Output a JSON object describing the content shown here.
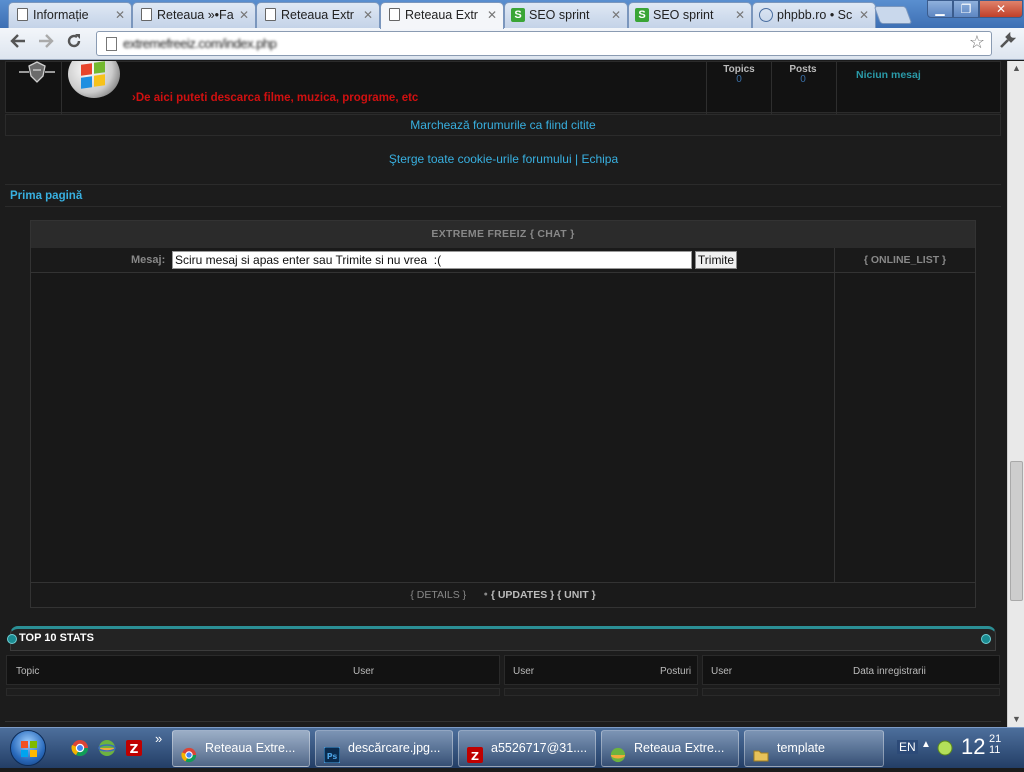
{
  "browser": {
    "tabs": [
      {
        "label": "Informație",
        "icon": "document-icon"
      },
      {
        "label": "Reteaua »•Fa",
        "icon": "document-icon"
      },
      {
        "label": "Reteaua Extr",
        "icon": "document-icon"
      },
      {
        "label": "Reteaua Extr",
        "icon": "document-icon",
        "active": true
      },
      {
        "label": "SEO sprint",
        "icon": "seo-sprint-icon"
      },
      {
        "label": "SEO sprint",
        "icon": "seo-sprint-icon"
      },
      {
        "label": "phpbb.ro • Sc",
        "icon": "phpbb-icon"
      }
    ],
    "tab_close": "✕",
    "url": "extremefreeiz.com/index.php",
    "nav": {
      "back": "back-arrow-icon",
      "forward": "forward-arrow-icon",
      "reload": "reload-icon",
      "bookmark": "star-icon",
      "menu": "wrench-icon"
    }
  },
  "forum": {
    "description": "›De aici puteti descarca filme, muzica, programe, etc",
    "topics_label": "Topics",
    "topics_value": "0",
    "posts_label": "Posts",
    "posts_value": "0",
    "last_post": "Niciun mesaj",
    "mark_read": "Marchează forumurile ca fiind citite",
    "delete_cookies": "Şterge toate cookie-urile forumului",
    "separator": "|",
    "team": "Echipa",
    "breadcrumb": "Prima pagină"
  },
  "chat": {
    "title": "EXTREME FREEIZ { CHAT }",
    "message_label": "Mesaj:",
    "input_value": "Sciru mesaj si apas enter sau Trimite si nu vrea  :(",
    "send_label": "Trimite",
    "online_list": "{ ONLINE_LIST }",
    "footer_details": "{ DETAILS }",
    "footer_bullet": "●",
    "footer_updates": "{ UPDATES }",
    "footer_unit": "{ UNIT }"
  },
  "stats": {
    "title": "TOP 10 STATS",
    "columns": {
      "topic": "Topic",
      "topic_user": "User",
      "posters_user": "User",
      "posts": "Posturi",
      "new_user": "User",
      "reg_date": "Data inregistrarii"
    }
  },
  "taskbar": {
    "items": [
      {
        "label": "Reteaua Extre...",
        "icon": "chrome-icon",
        "active": true
      },
      {
        "label": "descărcare.jpg...",
        "icon": "photoshop-icon"
      },
      {
        "label": "a5526717@31....",
        "icon": "filezilla-icon"
      },
      {
        "label": "Reteaua Extre...",
        "icon": "browser-icon"
      },
      {
        "label": "template",
        "icon": "folder-icon"
      }
    ],
    "quicklaunch_more": "»",
    "language": "EN",
    "clock_hour": "12",
    "clock_minute_top": "21",
    "clock_minute_bottom": "11"
  },
  "colors": {
    "link": "#38b0e0",
    "forum_desc": "#d01010",
    "accent_teal": "#2b8f95"
  }
}
